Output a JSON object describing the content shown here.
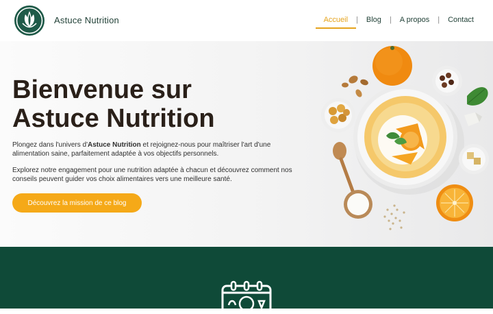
{
  "header": {
    "brand": "Astuce Nutrition",
    "logo_icon": "leaf-logo-icon",
    "nav": [
      {
        "label": "Accueil",
        "active": true
      },
      {
        "label": "Blog",
        "active": false
      },
      {
        "label": "A propos",
        "active": false
      },
      {
        "label": "Contact",
        "active": false
      }
    ],
    "separator": "|"
  },
  "hero": {
    "title_line1": "Bienvenue sur",
    "title_line2": "Astuce Nutrition",
    "para1_before": "Plongez dans l'univers d'",
    "para1_bold": "Astuce Nutrition",
    "para1_after": " et rejoignez-nous pour maîtriser l'art d'une alimentation saine, parfaitement adaptée à vos objectifs personnels.",
    "para2": "Explorez notre engagement pour une nutrition adaptée à chacun et découvrez comment nos conseils peuvent guider vos choix alimentaires vers une meilleure santé.",
    "cta_label": "Découvrez la mission de ce blog",
    "image": "healthy-food-bowl-image"
  },
  "band": {
    "icon": "calendar-food-icon"
  },
  "colors": {
    "accent": "#f5a918",
    "brand_green": "#0f4a38",
    "title": "#2a2019"
  }
}
